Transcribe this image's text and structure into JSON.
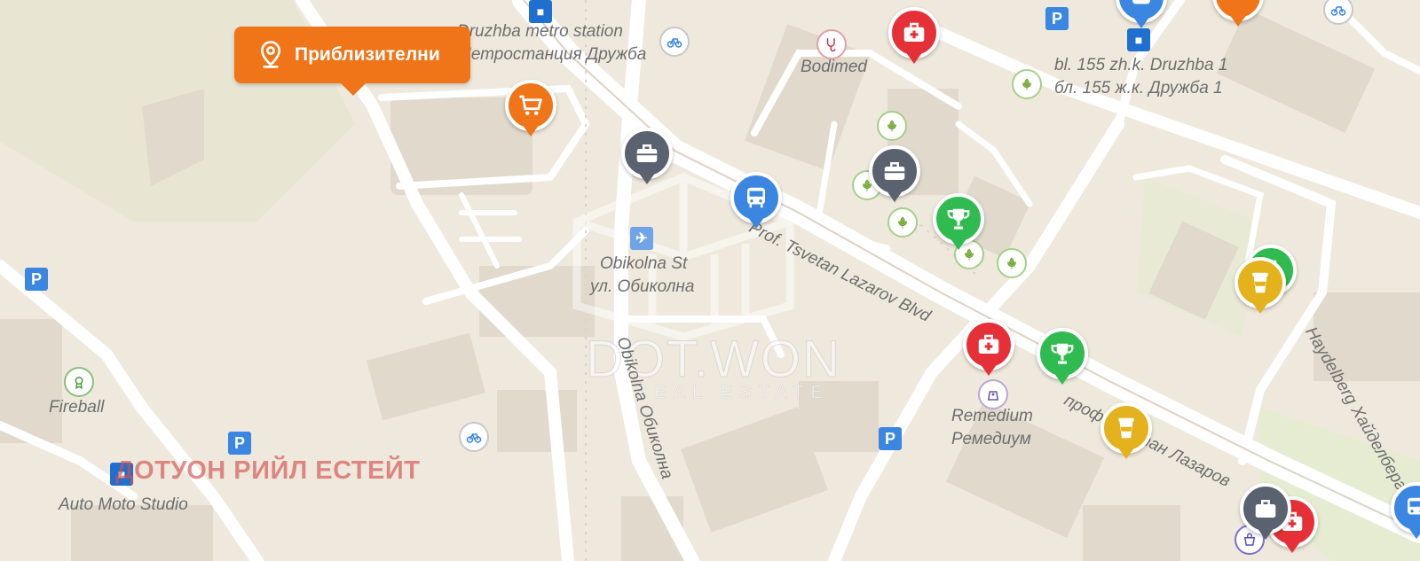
{
  "nearby_button": {
    "label": "Приблизителни",
    "icon": "location-pin-icon"
  },
  "watermark": {
    "text": "ДОТУОН РИЙЛ ЕСТЕЙТ",
    "logo_main": "DOT.WON",
    "logo_sub": "REAL ESTATE"
  },
  "places": {
    "druzhba_metro_en": "Druzhba metro station",
    "druzhba_metro_bg": "Метростанция Дружба",
    "bodimed": "Bodimed",
    "bl155_en": "bl. 155 zh.k. Druzhba 1",
    "bl155_bg": "бл. 155 ж.к. Дружба 1",
    "obikolna_en": "Obikolna St",
    "obikolna_bg": "ул. Обиколна",
    "remedium_en": "Remedium",
    "remedium_bg": "Ремедиум",
    "fireball": "Fireball",
    "auto_moto": "Auto Moto Studio"
  },
  "streets": {
    "tsvetan_lazarov_en": "Prof. Tsvetan Lazarov Blvd",
    "tsvetan_lazarov_bg": "проф. Цветан Лазаров",
    "obikolna_vertical": "Obikolna Обиколна",
    "haydelberg": "Haydelberg Хайделберг"
  },
  "colors": {
    "map_bg": "#efe9dd",
    "block": "#e2dccf",
    "road": "#ffffff",
    "medical": "#e53038",
    "shopping": "#f07418",
    "business": "#5a6270",
    "transit": "#3a86e0",
    "sport": "#2fbb4f",
    "cafe": "#e4b21c",
    "parking": "#3a86e0",
    "park": "#88b84a"
  },
  "pins": [
    {
      "type": "medical",
      "icon": "medical-kit-icon"
    },
    {
      "type": "shopping",
      "icon": "shopping-cart-icon"
    },
    {
      "type": "business",
      "icon": "briefcase-icon"
    },
    {
      "type": "business",
      "icon": "briefcase-icon"
    },
    {
      "type": "transit",
      "icon": "bus-icon"
    },
    {
      "type": "sport",
      "icon": "trophy-icon"
    },
    {
      "type": "medical",
      "icon": "medical-kit-icon"
    },
    {
      "type": "sport",
      "icon": "trophy-icon"
    },
    {
      "type": "cafe",
      "icon": "coffee-cup-icon"
    },
    {
      "type": "cafe",
      "icon": "coffee-cup-icon"
    },
    {
      "type": "business",
      "icon": "briefcase-icon"
    },
    {
      "type": "medical",
      "icon": "medical-kit-icon"
    },
    {
      "type": "transit",
      "icon": "bus-icon"
    },
    {
      "type": "transit",
      "icon": "bus-icon"
    },
    {
      "type": "shopping",
      "icon": "shopping-bag-icon"
    }
  ],
  "map_icons": [
    "parking-icon",
    "bus-stop-icon",
    "bicycle-icon",
    "park-icon",
    "stethoscope-icon",
    "pharmacy-icon",
    "metro-icon",
    "fireball-icon"
  ]
}
